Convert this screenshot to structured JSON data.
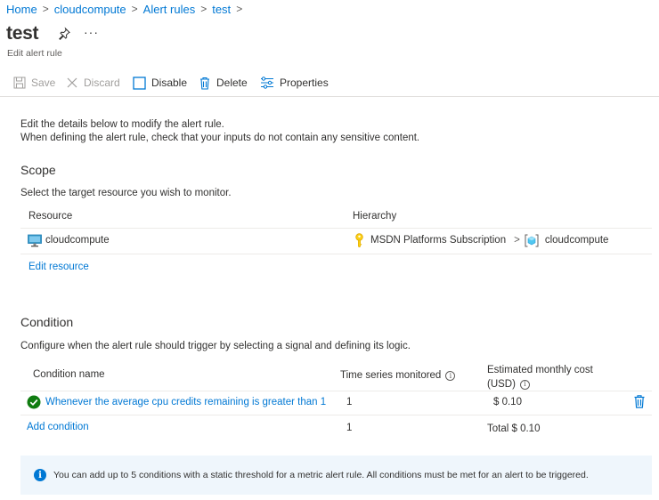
{
  "breadcrumb": {
    "items": [
      "Home",
      "cloudcompute",
      "Alert rules",
      "test"
    ],
    "separator": ">"
  },
  "header": {
    "title": "test",
    "more": "···",
    "subtitle": "Edit alert rule"
  },
  "toolbar": {
    "save": "Save",
    "discard": "Discard",
    "disable": "Disable",
    "delete": "Delete",
    "properties": "Properties"
  },
  "intro": {
    "line1": "Edit the details below to modify the alert rule.",
    "line2": "When defining the alert rule, check that your inputs do not contain any sensitive content."
  },
  "scope": {
    "title": "Scope",
    "description": "Select the target resource you wish to monitor.",
    "columns": {
      "resource": "Resource",
      "hierarchy": "Hierarchy"
    },
    "row": {
      "resource": "cloudcompute",
      "subscription": "MSDN Platforms Subscription",
      "separator": ">",
      "resource_group": "cloudcompute"
    },
    "edit_link": "Edit resource"
  },
  "condition": {
    "title": "Condition",
    "description": "Configure when the alert rule should trigger by selecting a signal and defining its logic.",
    "columns": {
      "name": "Condition name",
      "time_series": "Time series monitored",
      "cost_line1": "Estimated monthly cost",
      "cost_line2": "(USD)"
    },
    "row": {
      "name": "Whenever the average cpu credits remaining is greater than 1",
      "time_series": "1",
      "cost": "$ 0.10"
    },
    "add_row": {
      "label": "Add condition",
      "time_series": "1",
      "total": "Total $ 0.10"
    }
  },
  "info_bar": {
    "text": "You can add up to 5 conditions with a static threshold for a metric alert rule. All conditions must be met for an alert to be triggered."
  },
  "colors": {
    "accent": "#0078d4",
    "success": "#107c10",
    "info_bg": "#eff6fc",
    "key": "#fcd116"
  }
}
